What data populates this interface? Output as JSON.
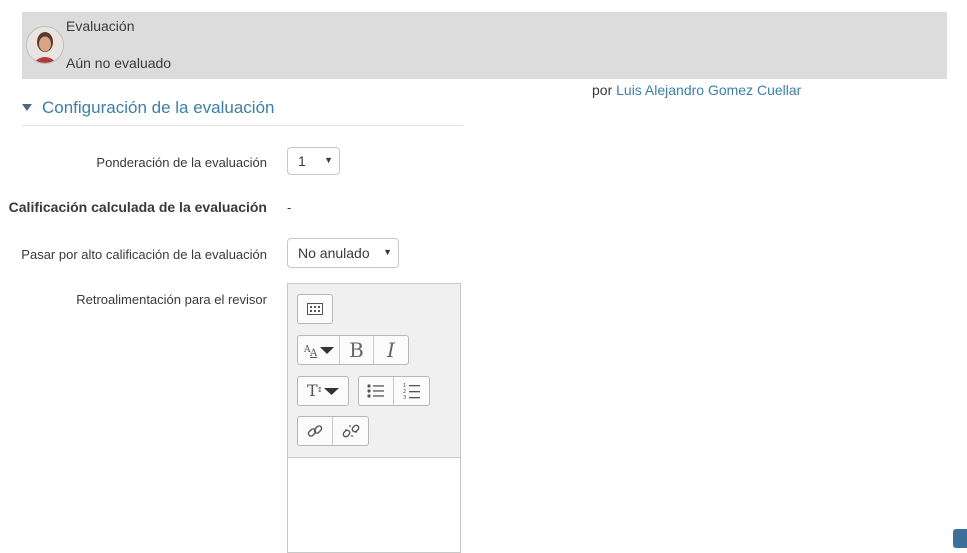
{
  "header": {
    "title": "Evaluación",
    "status": "Aún no evaluado"
  },
  "byline": {
    "prefix": "por",
    "author": "Luis Alejandro Gomez Cuellar"
  },
  "section": {
    "title": "Configuración de la evaluación"
  },
  "form": {
    "weight_label": "Ponderación de la evaluación",
    "weight_value": "1",
    "calc_label": "Calificación calculada de la evaluación",
    "calc_value": "-",
    "override_label": "Pasar por alto calificación de la evaluación",
    "override_value": "No anulado",
    "feedback_label": "Retroalimentación para el revisor"
  },
  "toolbar": {
    "icons": [
      "show-more-buttons-icon",
      "font-color-icon",
      "bold-icon",
      "italic-icon",
      "paragraph-styles-icon",
      "unordered-list-icon",
      "ordered-list-icon",
      "link-icon",
      "unlink-icon"
    ],
    "bold_glyph": "B",
    "italic_glyph": "I"
  },
  "colors": {
    "accent": "#3d7fa6",
    "header_bg": "#dcdcdc",
    "toolbar_bg": "#f0f0f0"
  }
}
